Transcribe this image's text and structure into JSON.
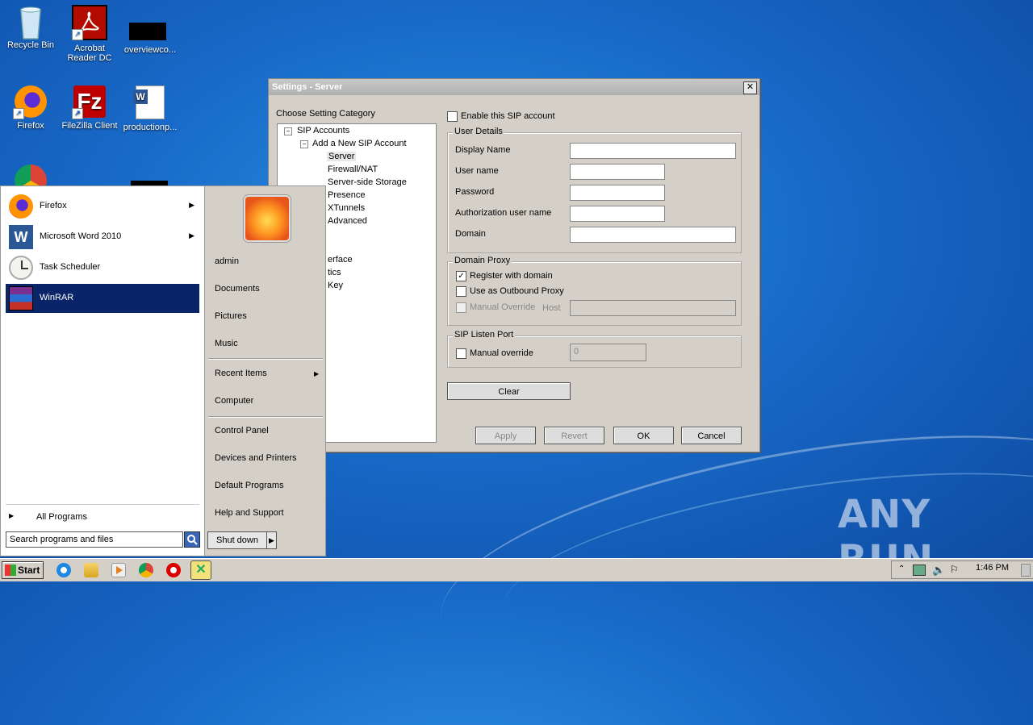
{
  "desktop": {
    "icons": [
      {
        "label": "Recycle Bin"
      },
      {
        "label": "Acrobat Reader DC"
      },
      {
        "label": "overviewco..."
      },
      {
        "label": "Firefox"
      },
      {
        "label": "FileZilla Client"
      },
      {
        "label": "productionp..."
      }
    ]
  },
  "dialog": {
    "title": "Settings - Server",
    "close_glyph": "✕",
    "category_label": "Choose Setting Category",
    "tree": [
      "SIP Accounts",
      "Add a New SIP Account",
      "Server",
      "Firewall/NAT",
      "Server-side Storage",
      "Presence",
      "XTunnels",
      "Advanced",
      "erface",
      "tics",
      "Key"
    ],
    "tree_expand_glyph": "−",
    "enable_label": "Enable this SIP account",
    "user_details": {
      "title": "User Details",
      "display_name": "Display Name",
      "user_name": "User name",
      "password": "Password",
      "auth_user_name": "Authorization user name",
      "domain": "Domain"
    },
    "domain_proxy": {
      "title": "Domain Proxy",
      "register": "Register with domain",
      "outbound": "Use as Outbound Proxy",
      "manual": "Manual Override",
      "host": "Host"
    },
    "listen_port": {
      "title": "SIP Listen Port",
      "manual": "Manual override",
      "value": "0"
    },
    "checkmark": "✓",
    "buttons": {
      "clear": "Clear",
      "apply": "Apply",
      "revert": "Revert",
      "ok": "OK",
      "cancel": "Cancel"
    }
  },
  "start_menu": {
    "programs": [
      {
        "label": "Firefox",
        "arrow": "▶"
      },
      {
        "label": "Microsoft Word 2010",
        "arrow": "▶"
      },
      {
        "label": "Task Scheduler"
      },
      {
        "label": "WinRAR"
      }
    ],
    "all_programs": "All Programs",
    "all_programs_arrow": "▶",
    "search_placeholder": "Search programs and files",
    "right_items": [
      "admin",
      "Documents",
      "Pictures",
      "Music",
      "Recent Items",
      "Computer",
      "Control Panel",
      "Devices and Printers",
      "Default Programs",
      "Help and Support"
    ],
    "recent_arrow": "▶",
    "shutdown": "Shut down",
    "shutdown_arrow": "▶"
  },
  "taskbar": {
    "start_label": "Start",
    "clock": "1:46 PM"
  },
  "watermark": "ANY RUN"
}
